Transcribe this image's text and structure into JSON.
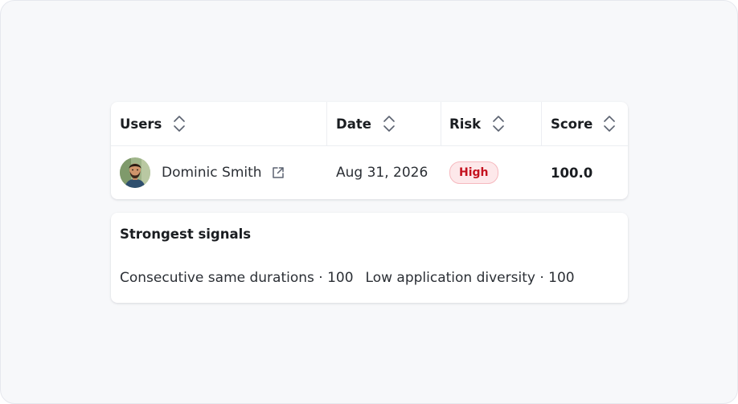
{
  "table": {
    "headers": {
      "users": "Users",
      "date": "Date",
      "risk": "Risk",
      "score": "Score"
    },
    "rows": [
      {
        "user": "Dominic Smith",
        "date": "Aug 31, 2026",
        "risk": "High",
        "score": "100.0"
      }
    ]
  },
  "signals": {
    "title": "Strongest signals",
    "items": [
      {
        "label": "Consecutive same durations · 100"
      },
      {
        "label": "Low application diversity · 100"
      }
    ]
  },
  "colors": {
    "risk_high_text": "#c4121f",
    "risk_high_bg": "#fde8ea",
    "risk_high_border": "#f6b9bf"
  },
  "icons": {
    "sort": "sort-updown-icon",
    "external": "external-link-icon"
  }
}
